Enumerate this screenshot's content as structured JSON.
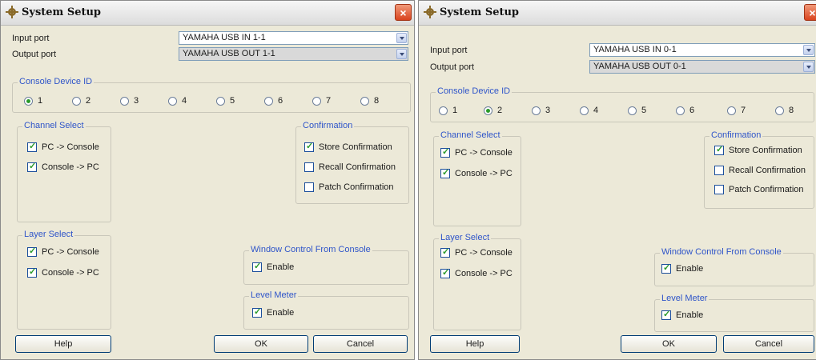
{
  "left_dialog": {
    "title": "System Setup",
    "close_label": "×",
    "input_port_label": "Input port",
    "input_port_value": "YAMAHA USB IN 1-1",
    "output_port_label": "Output port",
    "output_port_value": "YAMAHA USB OUT 1-1",
    "console_device_id_label": "Console Device ID",
    "device_ids": [
      "1",
      "2",
      "3",
      "4",
      "5",
      "6",
      "7",
      "8"
    ],
    "selected_device_id": "1",
    "channel_select_label": "Channel Select",
    "channel_pc_to_console": "PC -> Console",
    "channel_console_to_pc": "Console -> PC",
    "confirmation_label": "Confirmation",
    "store_confirmation": "Store Confirmation",
    "recall_confirmation": "Recall Confirmation",
    "patch_confirmation": "Patch Confirmation",
    "layer_select_label": "Layer Select",
    "layer_pc_to_console": "PC -> Console",
    "layer_console_to_pc": "Console -> PC",
    "window_control_label": "Window Control From Console",
    "window_control_enable": "Enable",
    "level_meter_label": "Level Meter",
    "level_meter_enable": "Enable",
    "help_button": "Help",
    "ok_button": "OK",
    "cancel_button": "Cancel"
  },
  "right_dialog": {
    "title": "System Setup",
    "close_label": "×",
    "input_port_label": "Input port",
    "input_port_value": "YAMAHA USB IN 0-1",
    "output_port_label": "Output port",
    "output_port_value": "YAMAHA USB OUT 0-1",
    "console_device_id_label": "Console Device ID",
    "device_ids": [
      "1",
      "2",
      "3",
      "4",
      "5",
      "6",
      "7",
      "8"
    ],
    "selected_device_id": "2",
    "channel_select_label": "Channel Select",
    "channel_pc_to_console": "PC -> Console",
    "channel_console_to_pc": "Console -> PC",
    "confirmation_label": "Confirmation",
    "store_confirmation": "Store Confirmation",
    "recall_confirmation": "Recall Confirmation",
    "patch_confirmation": "Patch Confirmation",
    "layer_select_label": "Layer Select",
    "layer_pc_to_console": "PC -> Console",
    "layer_console_to_pc": "Console -> PC",
    "window_control_label": "Window Control From Console",
    "window_control_enable": "Enable",
    "level_meter_label": "Level Meter",
    "level_meter_enable": "Enable",
    "help_button": "Help",
    "ok_button": "OK",
    "cancel_button": "Cancel"
  },
  "colors": {
    "dialog_bg": "#ece9d8",
    "group_label": "#2f55c9",
    "check_mark": "#2a9a2a",
    "close_button": "#d9431e"
  },
  "icons": {
    "title": "gear-icon",
    "close": "close-icon"
  }
}
